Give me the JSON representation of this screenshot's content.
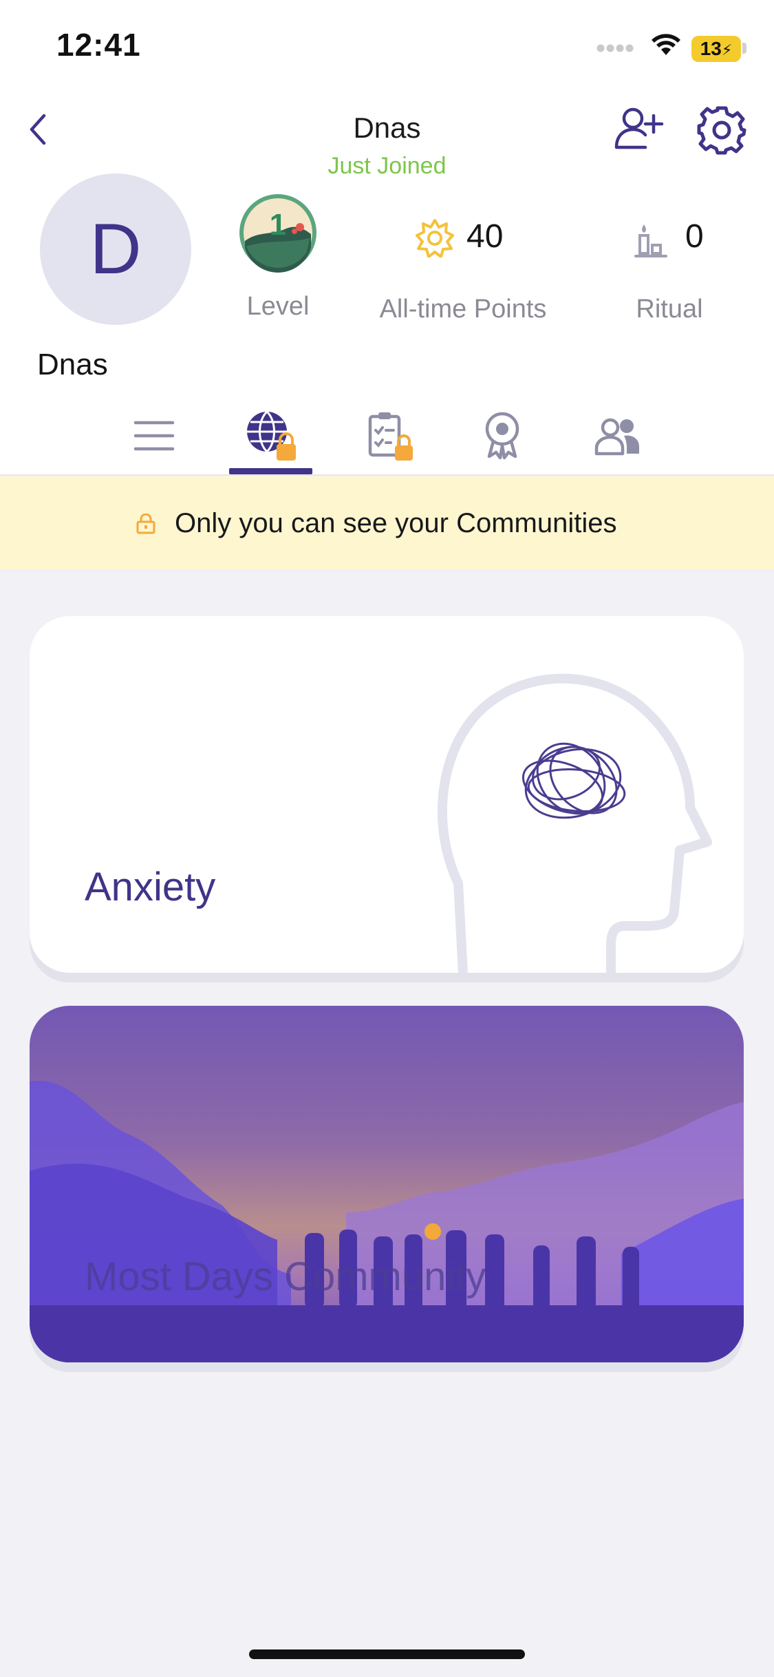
{
  "status_bar": {
    "time": "12:41",
    "battery": "13"
  },
  "header": {
    "title": "Dnas",
    "subtitle": "Just Joined",
    "subtitle_color": "#7cc64b",
    "icons": [
      "back-chevron-icon",
      "add-friend-icon",
      "gear-icon"
    ]
  },
  "profile": {
    "avatar_initial": "D",
    "username": "Dnas",
    "level": {
      "badge_number": "1",
      "label": "Level"
    },
    "points": {
      "value": "40",
      "label": "All-time Points",
      "icon": "sun-badge-icon"
    },
    "ritual": {
      "value": "0",
      "label": "Ritual",
      "icon": "candle-icon"
    }
  },
  "tabs": [
    {
      "name": "feed",
      "icon": "list-icon",
      "locked": false,
      "active": false
    },
    {
      "name": "communities",
      "icon": "globe-icon",
      "locked": true,
      "active": true
    },
    {
      "name": "checklist",
      "icon": "clipboard-icon",
      "locked": true,
      "active": false
    },
    {
      "name": "achievements",
      "icon": "award-icon",
      "locked": false,
      "active": false
    },
    {
      "name": "friends",
      "icon": "people-icon",
      "locked": false,
      "active": false
    }
  ],
  "notice": {
    "text": "Only you can see your Communities",
    "icon": "lock-icon"
  },
  "communities": [
    {
      "title": "Anxiety"
    },
    {
      "title": "Most Days Community"
    }
  ],
  "colors": {
    "accent": "#3f3489",
    "lock_orange": "#f4a93a",
    "notice_bg": "#fdf6cf",
    "page_bg": "#f1f1f6"
  }
}
